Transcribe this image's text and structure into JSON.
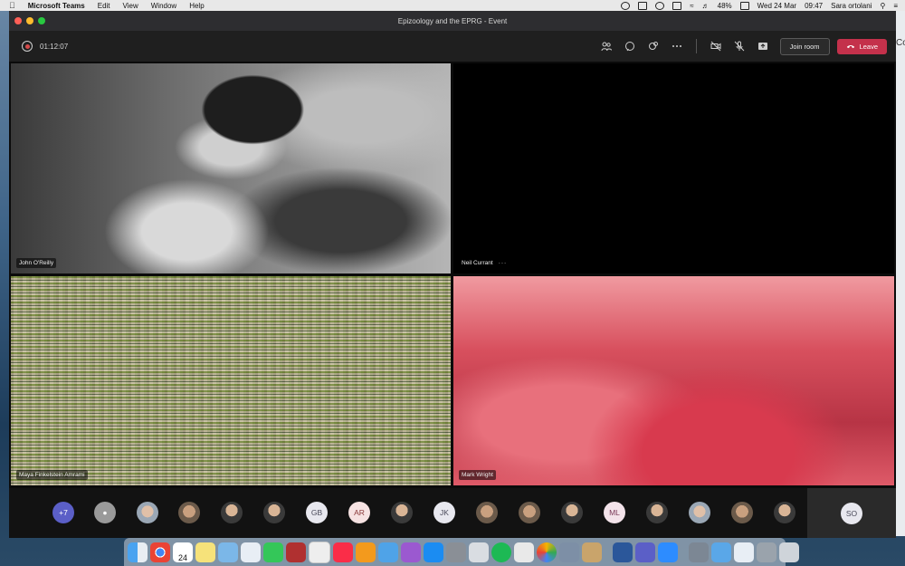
{
  "menubar": {
    "app_name": "Microsoft Teams",
    "menus": [
      "Edit",
      "View",
      "Window",
      "Help"
    ],
    "battery": "48%",
    "date": "Wed 24 Mar",
    "time": "09:47",
    "user": "Sara ortolani"
  },
  "window": {
    "title": "Epizoology and the EPRG - Event"
  },
  "toolbar": {
    "elapsed": "01:12:07",
    "join_label": "Join room",
    "leave_label": "Leave"
  },
  "tiles": [
    {
      "name": "John O'Reilly"
    },
    {
      "name": "Neil Currant",
      "more": "···"
    },
    {
      "name": "Maya Finkelstein Amrami"
    },
    {
      "name": "Mark Wright"
    }
  ],
  "strip": {
    "more_count": "+7",
    "initials": [
      "GB",
      "AR",
      "JK",
      "ML"
    ],
    "self_initials": "SO"
  },
  "desktop_edge_text": "Co",
  "dock_date": "24"
}
